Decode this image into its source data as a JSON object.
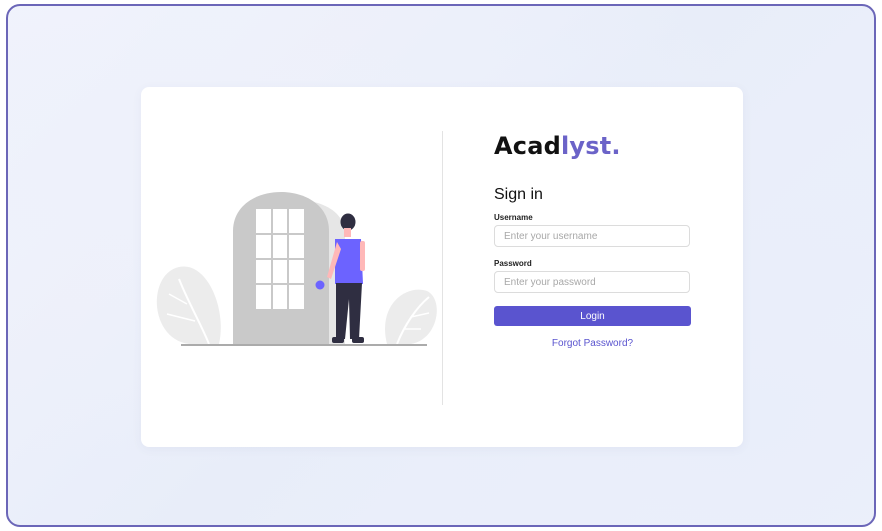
{
  "brand": {
    "name_main": "Acad",
    "name_accent": "lyst.",
    "accent_color": "#6b63c8"
  },
  "form": {
    "title": "Sign in",
    "username": {
      "label": "Username",
      "placeholder": "Enter your username",
      "value": ""
    },
    "password": {
      "label": "Password",
      "placeholder": "Enter your password",
      "value": ""
    },
    "login_label": "Login",
    "forgot_label": "Forgot Password?"
  },
  "illustration": {
    "icon": "person-at-door-illustration"
  },
  "colors": {
    "primary": "#5a54cf",
    "frame_border": "#6b66b8"
  }
}
